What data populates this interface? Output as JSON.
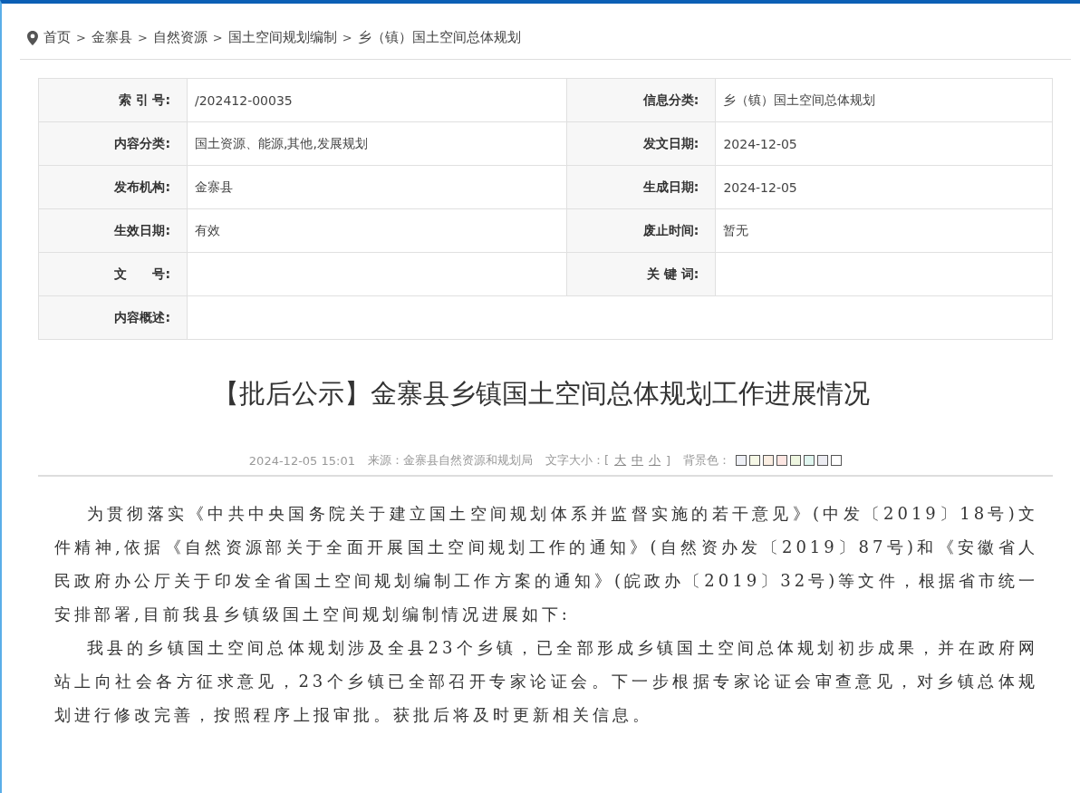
{
  "breadcrumb": [
    "首页",
    "金寨县",
    "自然资源",
    "国土空间规划编制",
    "乡（镇）国土空间总体规划"
  ],
  "breadcrumb_separator": ">",
  "info_table": [
    [
      {
        "label": "索 引 号:",
        "value": "/202412-00035"
      },
      {
        "label": "信息分类:",
        "value": "乡（镇）国土空间总体规划"
      }
    ],
    [
      {
        "label": "内容分类:",
        "value": "国土资源、能源,其他,发展规划"
      },
      {
        "label": "发文日期:",
        "value": "2024-12-05"
      }
    ],
    [
      {
        "label": "发布机构:",
        "value": "金寨县"
      },
      {
        "label": "生成日期:",
        "value": "2024-12-05"
      }
    ],
    [
      {
        "label": "生效日期:",
        "value": "有效"
      },
      {
        "label": "废止时间:",
        "value": "暂无"
      }
    ],
    [
      {
        "label": "文　　号:"
      },
      {
        "label": "关 键 词:"
      }
    ],
    [
      {
        "label": "内容概述:"
      }
    ]
  ],
  "article": {
    "title": "【批后公示】金寨县乡镇国土空间总体规划工作进展情况",
    "date": "2024-12-05 15:01",
    "source": "来源：金寨县自然资源和规划局",
    "font_size_label": "文字大小：[",
    "font_sizes": [
      "大",
      "中",
      "小"
    ],
    "font_size_close": "]",
    "background_label": "背景色：",
    "background_colors": [
      {
        "color": "#eef0f6"
      },
      {
        "color": "#f6f8e6"
      },
      {
        "color": "#fbeee2"
      },
      {
        "color": "#fde6e2"
      },
      {
        "color": "#eef6e0"
      },
      {
        "color": "#e0f6f0"
      },
      {
        "color": "#ececf2"
      },
      {
        "color": "#ffffff"
      }
    ],
    "paragraphs": [
      "为贯彻落实《中共中央国务院关于建立国土空间规划体系并监督实施的若干意见》(中发〔2019〕18号)文件精神,依据《自然资源部关于全面开展国土空间规划工作的通知》(自然资办发〔2019〕87号)和《安徽省人民政府办公厅关于印发全省国土空间规划编制工作方案的通知》(皖政办〔2019〕32号)等文件，根据省市统一安排部署,目前我县乡镇级国土空间规划编制情况进展如下:",
      "我县的乡镇国土空间总体规划涉及全县23个乡镇，已全部形成乡镇国土空间总体规划初步成果，并在政府网站上向社会各方征求意见，23个乡镇已全部召开专家论证会。下一步根据专家论证会审查意见，对乡镇总体规划进行修改完善，按照程序上报审批。获批后将及时更新相关信息。"
    ]
  }
}
